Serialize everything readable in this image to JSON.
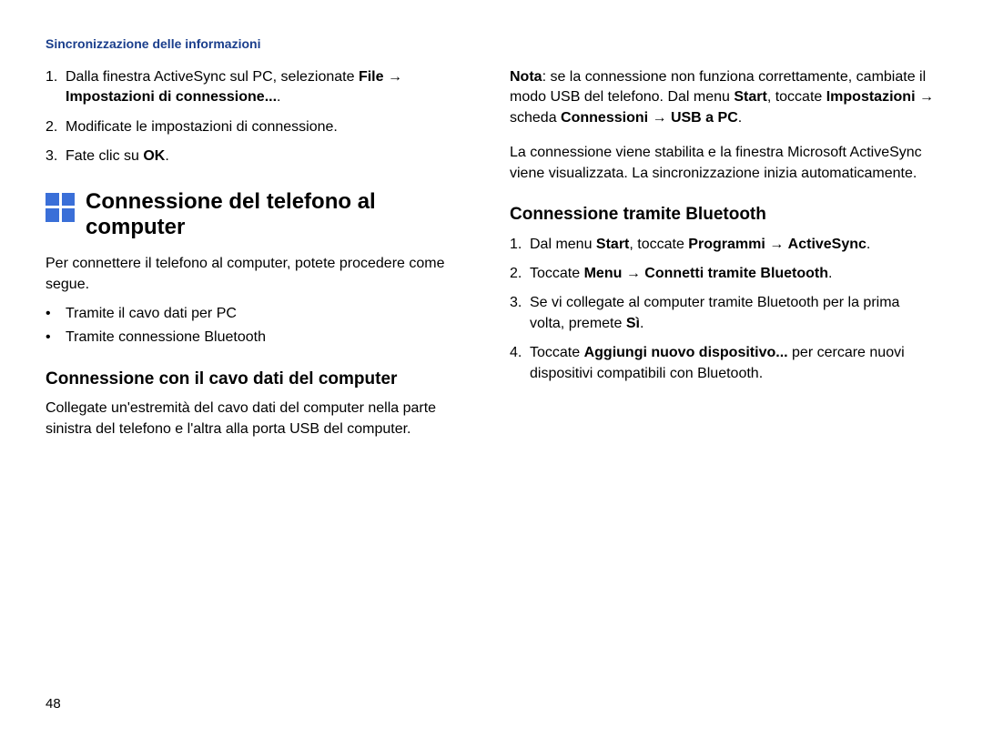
{
  "header": "Sincronizzazione delle informazioni",
  "left": {
    "ol": [
      {
        "num": "1.",
        "parts": [
          {
            "t": "Dalla finestra ActiveSync sul PC, selezionate ",
            "b": false
          },
          {
            "t": "File",
            "b": true
          },
          {
            "t": " → ",
            "b": false
          },
          {
            "t": "Impostazioni di connessione...",
            "b": true
          },
          {
            "t": ".",
            "b": false
          }
        ]
      },
      {
        "num": "2.",
        "parts": [
          {
            "t": "Modificate le impostazioni di connessione.",
            "b": false
          }
        ]
      },
      {
        "num": "3.",
        "parts": [
          {
            "t": "Fate clic su ",
            "b": false
          },
          {
            "t": "OK",
            "b": true
          },
          {
            "t": ".",
            "b": false
          }
        ]
      }
    ],
    "title": "Connessione del telefono al computer",
    "intro": "Per connettere il telefono al computer, potete procedere come segue.",
    "bullets": [
      "Tramite il cavo dati per PC",
      "Tramite connessione Bluetooth"
    ],
    "sub1": "Connessione con il cavo dati del computer",
    "sub1_para": "Collegate un'estremità del cavo dati del computer nella parte sinistra del telefono e l'altra alla porta USB del computer."
  },
  "right": {
    "note_label": "Nota",
    "note_parts": [
      {
        "t": ": se la connessione non funziona correttamente, cambiate il modo USB del telefono. Dal menu ",
        "b": false
      },
      {
        "t": "Start",
        "b": true
      },
      {
        "t": ", toccate ",
        "b": false
      },
      {
        "t": "Impostazioni",
        "b": true
      },
      {
        "t": " → scheda ",
        "b": false
      },
      {
        "t": "Connessioni",
        "b": true
      },
      {
        "t": " → ",
        "b": false
      },
      {
        "t": "USB a PC",
        "b": true
      },
      {
        "t": ".",
        "b": false
      }
    ],
    "para1": "La connessione viene stabilita e la finestra Microsoft ActiveSync viene visualizzata. La sincronizzazione inizia automaticamente.",
    "sub1": "Connessione tramite Bluetooth",
    "ol": [
      {
        "num": "1.",
        "parts": [
          {
            "t": "Dal menu ",
            "b": false
          },
          {
            "t": "Start",
            "b": true
          },
          {
            "t": ", toccate ",
            "b": false
          },
          {
            "t": "Programmi",
            "b": true
          },
          {
            "t": " → ",
            "b": false
          },
          {
            "t": "ActiveSync",
            "b": true
          },
          {
            "t": ".",
            "b": false
          }
        ]
      },
      {
        "num": "2.",
        "parts": [
          {
            "t": "Toccate ",
            "b": false
          },
          {
            "t": "Menu",
            "b": true
          },
          {
            "t": " → ",
            "b": false
          },
          {
            "t": "Connetti tramite Bluetooth",
            "b": true
          },
          {
            "t": ".",
            "b": false
          }
        ]
      },
      {
        "num": "3.",
        "parts": [
          {
            "t": "Se vi collegate al computer tramite Bluetooth per la prima volta, premete ",
            "b": false
          },
          {
            "t": "Sì",
            "b": true
          },
          {
            "t": ".",
            "b": false
          }
        ]
      },
      {
        "num": "4.",
        "parts": [
          {
            "t": "Toccate ",
            "b": false
          },
          {
            "t": "Aggiungi nuovo dispositivo...",
            "b": true
          },
          {
            "t": " per cercare nuovi dispositivi compatibili con Bluetooth.",
            "b": false
          }
        ]
      }
    ]
  },
  "page_num": "48"
}
